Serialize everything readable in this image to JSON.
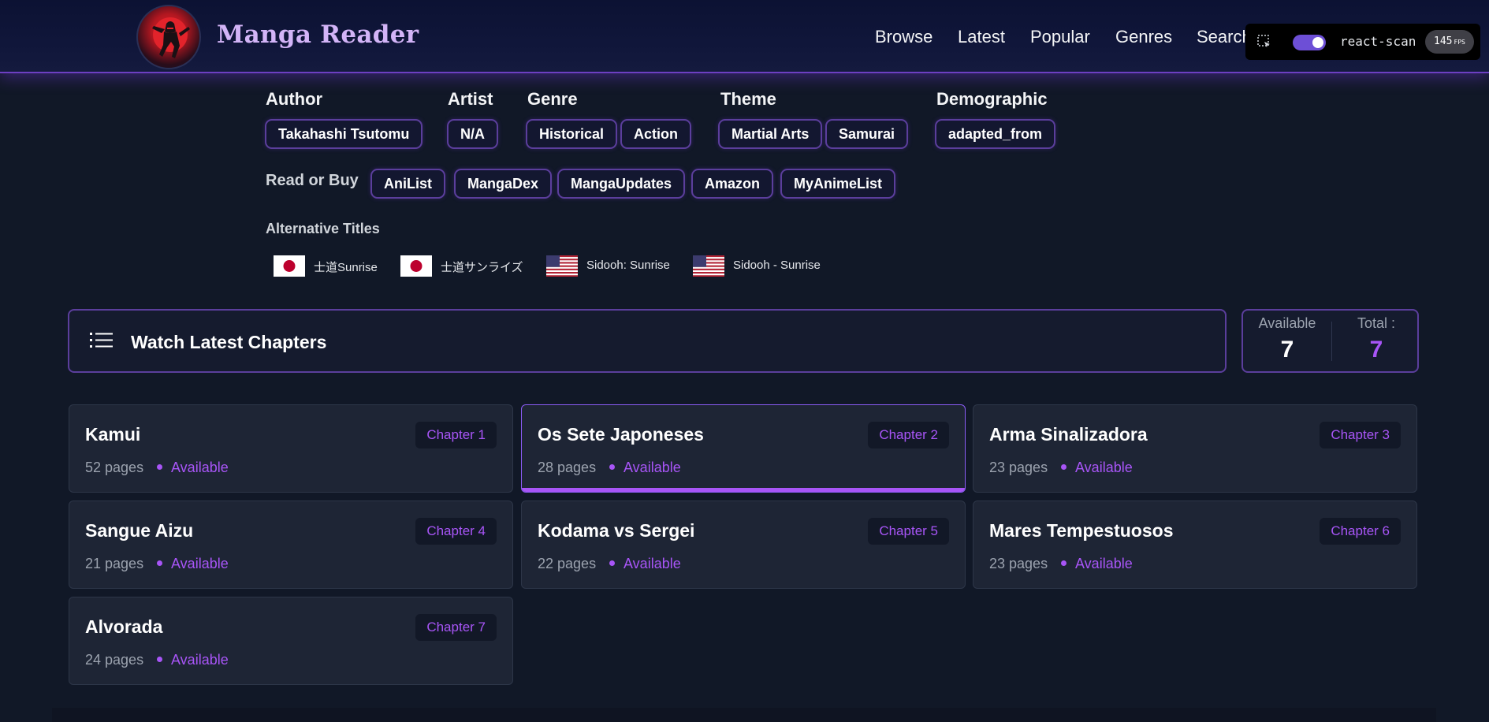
{
  "header": {
    "brand": "Manga Reader",
    "nav": [
      "Browse",
      "Latest",
      "Popular",
      "Genres",
      "Search"
    ]
  },
  "react_scan": {
    "label": "react-scan",
    "fps": "145",
    "fps_unit": "FPS",
    "toggle_on": true
  },
  "meta": {
    "author_label": "Author",
    "author": "Takahashi Tsutomu",
    "artist_label": "Artist",
    "artist": "N/A",
    "genre_label": "Genre",
    "genres": [
      "Historical",
      "Action"
    ],
    "theme_label": "Theme",
    "themes": [
      "Martial Arts",
      "Samurai"
    ],
    "demographic_label": "Demographic",
    "demographic": "adapted_from",
    "read_label": "Read or Buy",
    "read_links": [
      "AniList",
      "MangaDex",
      "MangaUpdates",
      "Amazon",
      "MyAnimeList"
    ]
  },
  "alt_titles": {
    "label": "Alternative Titles",
    "items": [
      {
        "flag": "jp-flag-icon",
        "title": "士道Sunrise"
      },
      {
        "flag": "jp-flag-icon",
        "title": "士道サンライズ"
      },
      {
        "flag": "us-flag-icon",
        "title": "Sidooh: Sunrise"
      },
      {
        "flag": "us-flag-icon",
        "title": "Sidooh - Sunrise"
      }
    ]
  },
  "chapters_section": {
    "title": "Watch Latest Chapters",
    "available_label": "Available",
    "available": "7",
    "total_label": "Total :",
    "total": "7"
  },
  "chapters": [
    {
      "title": "Kamui",
      "badge": "Chapter 1",
      "pages": "52 pages",
      "status": "Available"
    },
    {
      "title": "Os Sete Japoneses",
      "badge": "Chapter 2",
      "pages": "28 pages",
      "status": "Available"
    },
    {
      "title": "Arma Sinalizadora",
      "badge": "Chapter 3",
      "pages": "23 pages",
      "status": "Available"
    },
    {
      "title": "Sangue Aizu",
      "badge": "Chapter 4",
      "pages": "21 pages",
      "status": "Available"
    },
    {
      "title": "Kodama vs Sergei",
      "badge": "Chapter 5",
      "pages": "22 pages",
      "status": "Available"
    },
    {
      "title": "Mares Tempestuosos",
      "badge": "Chapter 6",
      "pages": "23 pages",
      "status": "Available"
    },
    {
      "title": "Alvorada",
      "badge": "Chapter 7",
      "pages": "24 pages",
      "status": "Available"
    }
  ],
  "colors": {
    "accent": "#a855f7",
    "border": "#5b3e9c",
    "background": "#111827",
    "card": "#1e2535"
  }
}
